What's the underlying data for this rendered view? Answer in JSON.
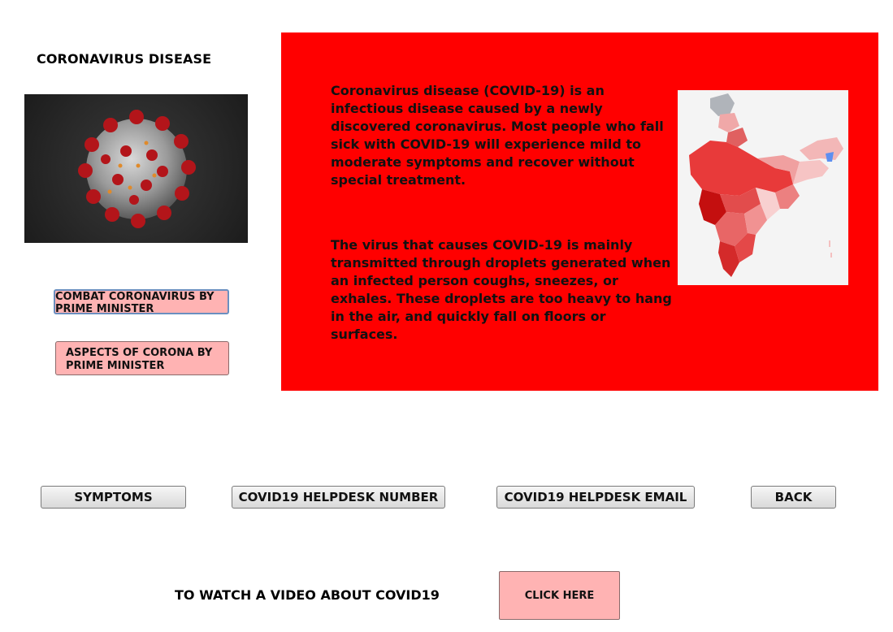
{
  "header": {
    "title": "CORONAVIRUS DISEASE"
  },
  "left_buttons": {
    "combat_label": "COMBAT CORONAVIRUS BY PRIME MINISTER",
    "aspects_label": "ASPECTS OF CORONA BY PRIME MINISTER"
  },
  "info": {
    "paragraph1": "Coronavirus disease (COVID-19) is an infectious disease caused by a newly discovered coronavirus. Most people who fall sick with COVID-19 will experience mild to moderate symptoms and recover without special treatment.",
    "paragraph2": "The virus that causes COVID-19 is mainly transmitted through droplets generated when an infected person coughs, sneezes, or exhales. These droplets are too heavy to hang in the air, and quickly fall on floors or surfaces."
  },
  "nav": {
    "symptoms_label": "SYMPTOMS",
    "helpdesk_number_label": "COVID19 HELPDESK NUMBER",
    "helpdesk_email_label": "COVID19 HELPDESK EMAIL",
    "back_label": "BACK"
  },
  "video": {
    "prompt": "TO WATCH A VIDEO ABOUT COVID19",
    "button_label": "CLICK HERE"
  },
  "colors": {
    "panel": "#ff0000",
    "pink_button": "#ffb3b3"
  },
  "icons": {
    "virus_image": "coronavirus-illustration",
    "map_image": "india-covid-map"
  }
}
